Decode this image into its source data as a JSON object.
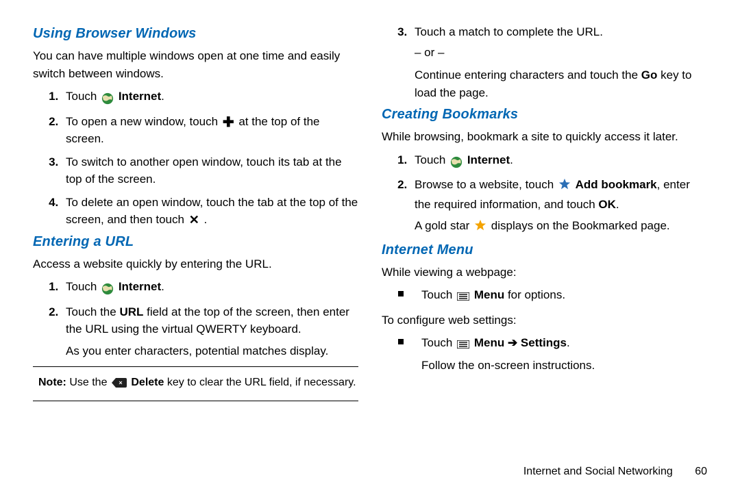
{
  "left": {
    "heading1": "Using Browser Windows",
    "intro1": "You can have multiple windows open at one time and easily switch between windows.",
    "steps1": {
      "s1a": "Touch ",
      "s1b": "Internet",
      "s1c": ".",
      "s2a": "To open a new window, touch ",
      "s2b": " at the top of the screen.",
      "s3": "To switch to another open window, touch its tab at the top of the screen.",
      "s4a": "To delete an open window, touch the tab at the top of the screen, and then touch ",
      "s4b": "."
    },
    "heading2": "Entering a URL",
    "intro2": "Access a website quickly by entering the URL.",
    "steps2": {
      "s1a": "Touch ",
      "s1b": "Internet",
      "s1c": ".",
      "s2a": "Touch the ",
      "s2b": "URL",
      "s2c": " field at the top of the screen, then enter the URL using the virtual QWERTY keyboard.",
      "s2d": "As you enter characters, potential matches display."
    },
    "note": {
      "label": "Note:",
      "a": " Use the ",
      "b": "Delete",
      "c": " key to clear the URL field, if necessary."
    }
  },
  "right": {
    "cont": {
      "s3a": "Touch a match to complete the URL.",
      "or": "– or –",
      "s3b": "Continue entering characters and touch the ",
      "go": "Go",
      "s3c": " key to load the page."
    },
    "heading3": "Creating Bookmarks",
    "intro3": "While browsing, bookmark a site to quickly access it later.",
    "steps3": {
      "s1a": "Touch ",
      "s1b": "Internet",
      "s1c": ".",
      "s2a": "Browse to a website, touch ",
      "s2b": "Add bookmark",
      "s2c": ", enter the required information, and touch ",
      "s2d": "OK",
      "s2e": ".",
      "s2f": "A gold star ",
      "s2g": " displays on the Bookmarked page."
    },
    "heading4": "Internet Menu",
    "intro4a": "While viewing a webpage:",
    "menu1a": "Touch ",
    "menu1b": "Menu",
    "menu1c": " for options.",
    "intro4b": "To configure web settings:",
    "menu2a": "Touch ",
    "menu2b": "Menu",
    "menu2arrow": " ➔ ",
    "menu2c": "Settings",
    "menu2d": ".",
    "menu2e": "Follow the on-screen instructions."
  },
  "footer": {
    "section": "Internet and Social Networking",
    "page": "60"
  }
}
